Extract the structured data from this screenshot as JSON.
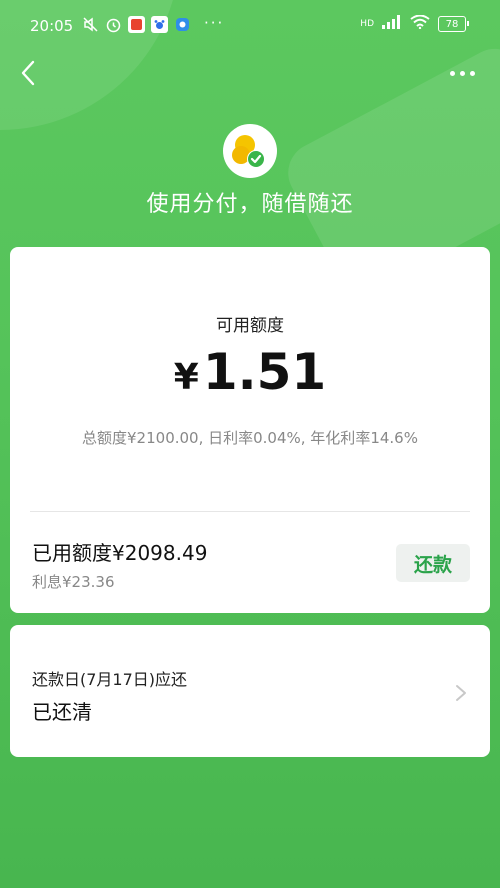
{
  "status_bar": {
    "time": "20:05",
    "left_icons": [
      "mute-icon",
      "alarm-icon",
      "app-badge-58-icon",
      "baidu-icon",
      "notification-icon"
    ],
    "more_dots": "···",
    "network_label": "HD",
    "battery": "78"
  },
  "header": {
    "back_icon": "chevron-left-icon",
    "more_icon": "more-dots-icon",
    "slogan": "使用分付，随借随还"
  },
  "credit_card": {
    "available_label": "可用额度",
    "currency": "¥",
    "available_amount": "1.51",
    "credit_info": "总额度¥2100.00, 日利率0.04%, 年化利率14.6%",
    "used_label": "已用额度¥2098.49",
    "interest_label": "利息¥23.36",
    "repay_button": "还款"
  },
  "repay_card": {
    "date_label": "还款日(7月17日)应还",
    "status": "已还清"
  },
  "colors": {
    "background_green": "#55c35a",
    "accent_green": "#2aa34a",
    "logo_yellow": "#f5c400"
  }
}
